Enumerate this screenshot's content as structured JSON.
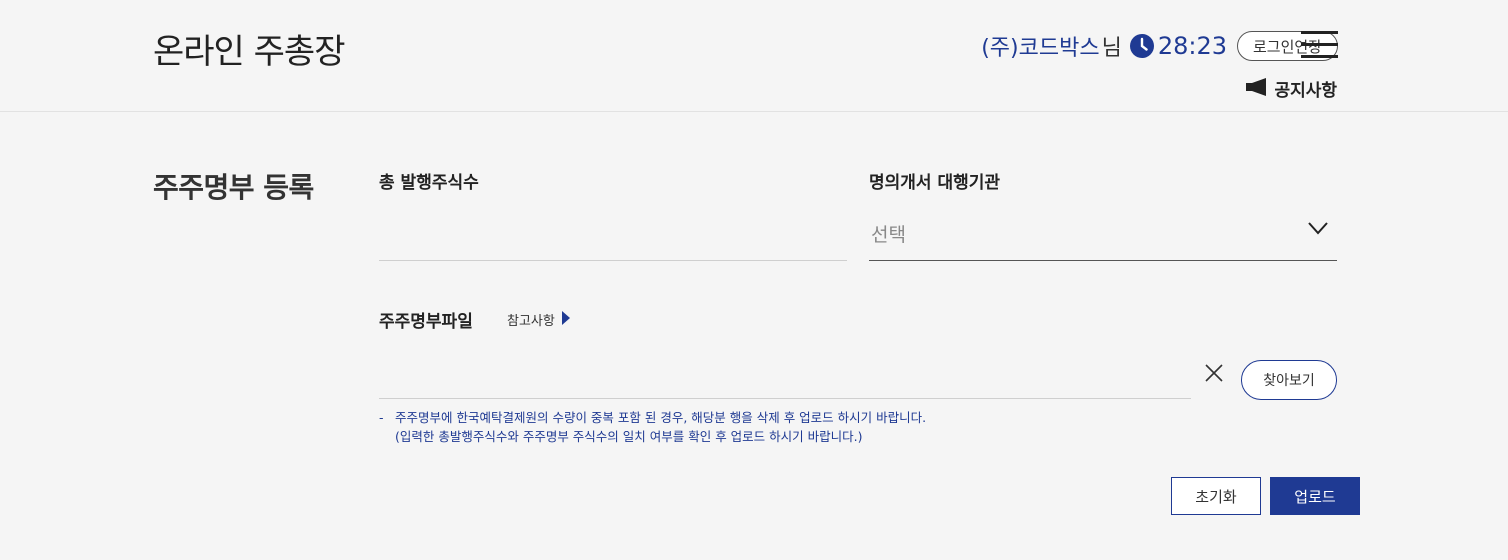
{
  "header": {
    "site_title": "온라인 주총장",
    "company_name": "(주)코드박스",
    "honorific": "님",
    "timer": "28:23",
    "extend_login_label": "로그인연장",
    "notice_label": "공지사항"
  },
  "form": {
    "section_title": "주주명부 등록",
    "total_shares_label": "총 발행주식수",
    "total_shares_value": "",
    "agent_label": "명의개서 대행기관",
    "agent_selected": "선택",
    "register_file_label": "주주명부파일",
    "reference_label": "참고사항",
    "file_value": "",
    "browse_label": "찾아보기",
    "notes": {
      "dash": "-",
      "line1": "주주명부에 한국예탁결제원의 수량이 중복 포함 된 경우, 해당분 행을 삭제 후 업로드 하시기 바랍니다.",
      "line2": "(입력한 총발행주식수와 주주명부 주식수의 일치 여부를 확인 후 업로드 하시기 바랍니다.)"
    },
    "reset_label": "초기화",
    "upload_label": "업로드"
  },
  "colors": {
    "accent": "#1f3a93",
    "background": "#f5f5f5"
  },
  "icons": {
    "clock": "clock-icon",
    "menu": "hamburger-menu-icon",
    "notice": "megaphone-icon",
    "chevron": "chevron-down-icon",
    "ref_arrow": "triangle-right-icon",
    "clear": "close-icon"
  }
}
